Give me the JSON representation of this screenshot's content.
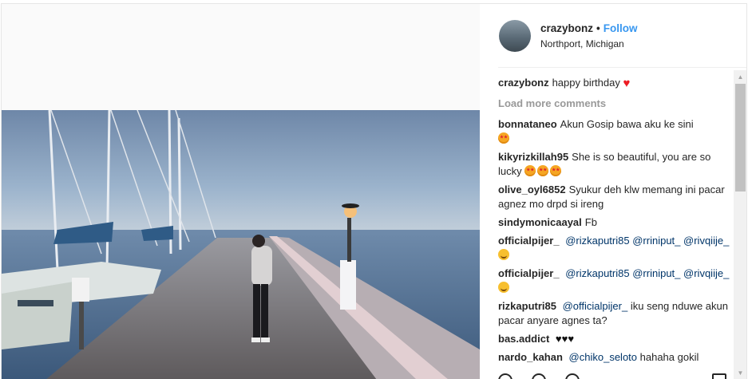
{
  "post": {
    "username": "crazybonz",
    "separator": "•",
    "follow_label": "Follow",
    "location": "Northport, Michigan"
  },
  "comments": {
    "load_more": "Load more comments",
    "caption": {
      "user": "crazybonz",
      "text": "happy birthday"
    },
    "items": [
      {
        "user": "bonnataneo",
        "text": "Akun Gosip bawa aku ke sini"
      },
      {
        "user": "kikyrizkillah95",
        "text": "She is so beautiful, you are so lucky"
      },
      {
        "user": "olive_oyl6852",
        "text": "Syukur deh klw memang ini pacar agnez mo drpd si ireng"
      },
      {
        "user": "sindymonicaayal",
        "text": "Fb"
      },
      {
        "user": "officialpijer_",
        "m1": "@rizkaputri85",
        "m2": "@rriniput_",
        "m3": "@rivqiije_"
      },
      {
        "user": "officialpijer_",
        "m1": "@rizkaputri85",
        "m2": "@rriniput_",
        "m3": "@rivqiije_"
      },
      {
        "user": "rizkaputri85",
        "m1": "@officialpijer_",
        "text": "iku seng nduwe akun pacar anyare agnes ta?"
      },
      {
        "user": "bas.addict",
        "text": ""
      },
      {
        "user": "nardo_kahan",
        "m1": "@chiko_seloto",
        "text": "hahaha gokil"
      }
    ]
  },
  "icons": {
    "heart": "red-heart-icon",
    "star_eyes": "star-struck-emoji-icon",
    "smirk": "smirking-emoji-icon",
    "black_hearts": "black-heart-icon"
  },
  "colors": {
    "accent": "#3897f0",
    "text": "#262626",
    "muted": "#999999",
    "mention": "#003569"
  }
}
